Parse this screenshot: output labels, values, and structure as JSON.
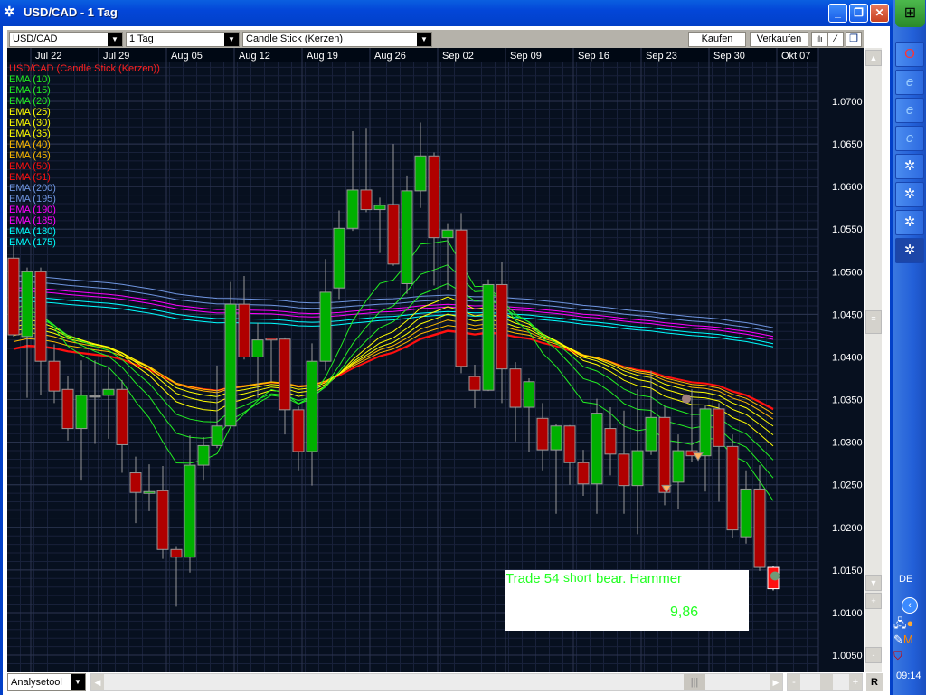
{
  "window": {
    "title": "USD/CAD - 1 Tag",
    "icon": "asterisk-app-icon"
  },
  "toolbar": {
    "symbol": "USD/CAD",
    "period": "1 Tag",
    "chart_type": "Candle Stick (Kerzen)",
    "buy_label": "Kaufen",
    "sell_label": "Verkaufen"
  },
  "legend": [
    {
      "label": "USD/CAD (Candle Stick (Kerzen))",
      "color": "#ff2020"
    },
    {
      "label": "EMA (10)",
      "color": "#22ee22"
    },
    {
      "label": "EMA (15)",
      "color": "#22ee22"
    },
    {
      "label": "EMA (20)",
      "color": "#22ee22"
    },
    {
      "label": "EMA (25)",
      "color": "#ffff00"
    },
    {
      "label": "EMA (30)",
      "color": "#ffff00"
    },
    {
      "label": "EMA (35)",
      "color": "#ffff00"
    },
    {
      "label": "EMA (40)",
      "color": "#ffbb00"
    },
    {
      "label": "EMA (45)",
      "color": "#ffbb00"
    },
    {
      "label": "EMA (50)",
      "color": "#ff1010"
    },
    {
      "label": "EMA (51)",
      "color": "#ff1010"
    },
    {
      "label": "EMA (200)",
      "color": "#6f95e0"
    },
    {
      "label": "EMA (195)",
      "color": "#6f95e0"
    },
    {
      "label": "EMA (190)",
      "color": "#ff00ff"
    },
    {
      "label": "EMA (185)",
      "color": "#ff00ff"
    },
    {
      "label": "EMA (180)",
      "color": "#00ffff"
    },
    {
      "label": "EMA (175)",
      "color": "#00ffff"
    }
  ],
  "chart_data": {
    "type": "candlestick",
    "date_ticks": [
      "Jul 22",
      "Jul 29",
      "Aug 05",
      "Aug 12",
      "Aug 19",
      "Aug 26",
      "Sep 02",
      "Sep 09",
      "Sep 16",
      "Sep 23",
      "Sep 30",
      "Okt 07"
    ],
    "price_ticks": [
      "1.0700",
      "1.0650",
      "1.0600",
      "1.0550",
      "1.0500",
      "1.0450",
      "1.0400",
      "1.0350",
      "1.0300",
      "1.0250",
      "1.0200",
      "1.0150",
      "1.0100",
      "1.0050"
    ],
    "ylim": [
      1.003,
      1.0765
    ],
    "grid": true,
    "up_color": "#00b000",
    "down_color": "#b00000",
    "last_color": "#ff1010",
    "ohlc": [
      [
        1.0516,
        1.0532,
        1.0424,
        1.0426
      ],
      [
        1.0424,
        1.0505,
        1.0352,
        1.05
      ],
      [
        1.05,
        1.0505,
        1.0355,
        1.0395
      ],
      [
        1.0395,
        1.0415,
        1.0346,
        1.036
      ],
      [
        1.0362,
        1.0378,
        1.0302,
        1.0316
      ],
      [
        1.0316,
        1.0396,
        1.0256,
        1.0355
      ],
      [
        1.0355,
        1.0396,
        1.0298,
        1.0355
      ],
      [
        1.0355,
        1.0389,
        1.0304,
        1.0362
      ],
      [
        1.0362,
        1.0373,
        1.0264,
        1.0297
      ],
      [
        1.0264,
        1.0283,
        1.0205,
        1.0241
      ],
      [
        1.024,
        1.0274,
        1.0219,
        1.0242
      ],
      [
        1.0243,
        1.0272,
        1.0163,
        1.0174
      ],
      [
        1.0174,
        1.0178,
        1.0107,
        1.0165
      ],
      [
        1.0165,
        1.0308,
        1.0147,
        1.0273
      ],
      [
        1.0273,
        1.0306,
        1.0256,
        1.0296
      ],
      [
        1.0296,
        1.039,
        1.0293,
        1.0319
      ],
      [
        1.0319,
        1.0488,
        1.0318,
        1.0462
      ],
      [
        1.0462,
        1.0495,
        1.0397,
        1.04
      ],
      [
        1.04,
        1.044,
        1.0352,
        1.042
      ],
      [
        1.0422,
        1.0422,
        1.0371,
        1.042
      ],
      [
        1.0421,
        1.0423,
        1.0309,
        1.0338
      ],
      [
        1.0338,
        1.0342,
        1.0267,
        1.0289
      ],
      [
        1.0289,
        1.0416,
        1.0249,
        1.0395
      ],
      [
        1.0395,
        1.0515,
        1.0384,
        1.0476
      ],
      [
        1.0481,
        1.0572,
        1.0468,
        1.0551
      ],
      [
        1.0551,
        1.0665,
        1.0548,
        1.0596
      ],
      [
        1.0596,
        1.0669,
        1.057,
        1.0573
      ],
      [
        1.0573,
        1.0587,
        1.0522,
        1.0578
      ],
      [
        1.0579,
        1.065,
        1.0507,
        1.0509
      ],
      [
        1.0486,
        1.0613,
        1.0474,
        1.0595
      ],
      [
        1.0595,
        1.0675,
        1.0575,
        1.0636
      ],
      [
        1.0636,
        1.064,
        1.0484,
        1.054
      ],
      [
        1.054,
        1.0557,
        1.0479,
        1.0549
      ],
      [
        1.0549,
        1.0569,
        1.0381,
        1.0389
      ],
      [
        1.0377,
        1.0391,
        1.034,
        1.0361
      ],
      [
        1.0361,
        1.0491,
        1.036,
        1.0485
      ],
      [
        1.0485,
        1.0511,
        1.0346,
        1.0386
      ],
      [
        1.0386,
        1.0394,
        1.0301,
        1.0341
      ],
      [
        1.0341,
        1.0375,
        1.0288,
        1.0371
      ],
      [
        1.0328,
        1.0346,
        1.0267,
        1.0291
      ],
      [
        1.0291,
        1.0321,
        1.0216,
        1.0319
      ],
      [
        1.0319,
        1.032,
        1.025,
        1.0276
      ],
      [
        1.0276,
        1.0291,
        1.0237,
        1.0251
      ],
      [
        1.0251,
        1.0351,
        1.0216,
        1.0334
      ],
      [
        1.0316,
        1.0341,
        1.0261,
        1.0286
      ],
      [
        1.0286,
        1.0337,
        1.0216,
        1.0249
      ],
      [
        1.0249,
        1.0362,
        1.0192,
        1.029
      ],
      [
        1.029,
        1.0384,
        1.0285,
        1.0329
      ],
      [
        1.0329,
        1.0342,
        1.0226,
        1.0241
      ],
      [
        1.0253,
        1.0309,
        1.0222,
        1.029
      ],
      [
        1.029,
        1.0362,
        1.0277,
        1.0284
      ],
      [
        1.0284,
        1.0343,
        1.0242,
        1.0339
      ],
      [
        1.0339,
        1.0346,
        1.023,
        1.0295
      ],
      [
        1.0295,
        1.0309,
        1.0187,
        1.0197
      ],
      [
        1.0189,
        1.0267,
        1.0181,
        1.0245
      ],
      [
        1.0245,
        1.0273,
        1.0149,
        1.0153
      ],
      [
        1.0153,
        1.0155,
        1.0126,
        1.0128
      ]
    ],
    "ema": [
      {
        "period": 10,
        "start": 1.0455,
        "color": "#22ee22"
      },
      {
        "period": 15,
        "start": 1.045,
        "color": "#22ee22"
      },
      {
        "period": 20,
        "start": 1.0445,
        "color": "#22ee22"
      },
      {
        "period": 25,
        "start": 1.044,
        "color": "#ffff00"
      },
      {
        "period": 30,
        "start": 1.0435,
        "color": "#ffff00"
      },
      {
        "period": 35,
        "start": 1.043,
        "color": "#ffff00"
      },
      {
        "period": 40,
        "start": 1.0425,
        "color": "#ffbb00"
      },
      {
        "period": 45,
        "start": 1.0418,
        "color": "#ffbb00"
      },
      {
        "period": 50,
        "start": 1.041,
        "color": "#ff1010"
      },
      {
        "period": 51,
        "start": 1.0409,
        "color": "#ff1010"
      },
      {
        "period": 200,
        "start": 1.0495,
        "color": "#6f95e0"
      },
      {
        "period": 195,
        "start": 1.0488,
        "color": "#6f95e0"
      },
      {
        "period": 190,
        "start": 1.0481,
        "color": "#ff00ff"
      },
      {
        "period": 185,
        "start": 1.0477,
        "color": "#ff00ff"
      },
      {
        "period": 180,
        "start": 1.047,
        "color": "#00ffff"
      },
      {
        "period": 175,
        "start": 1.0465,
        "color": "#00ffff"
      }
    ],
    "markers": [
      {
        "candle": 50,
        "price": 1.0351,
        "shape": "circle",
        "color": "#a08080"
      },
      {
        "candle": 48,
        "price": 1.0245,
        "shape": "triangle-down",
        "color": "#ffb060"
      },
      {
        "candle": 50,
        "price": 1.0283,
        "shape": "triangle-down",
        "color": "#ffb060"
      },
      {
        "candle": 56,
        "price": 1.0143,
        "shape": "circle",
        "color": "#709a78"
      }
    ]
  },
  "trade_box": {
    "trade": "Trade 54",
    "direction": "short",
    "pattern": "bear. Hammer",
    "value": "9,86"
  },
  "bottom": {
    "analysis_tool": "Analysetool",
    "reset_label": "R"
  },
  "taskbar": {
    "language": "DE",
    "clock": "09:14",
    "items": [
      "opera-icon",
      "ie-icon",
      "ie-icon",
      "ie-icon",
      "app-icon",
      "app-icon",
      "app-icon",
      "app-icon"
    ]
  }
}
